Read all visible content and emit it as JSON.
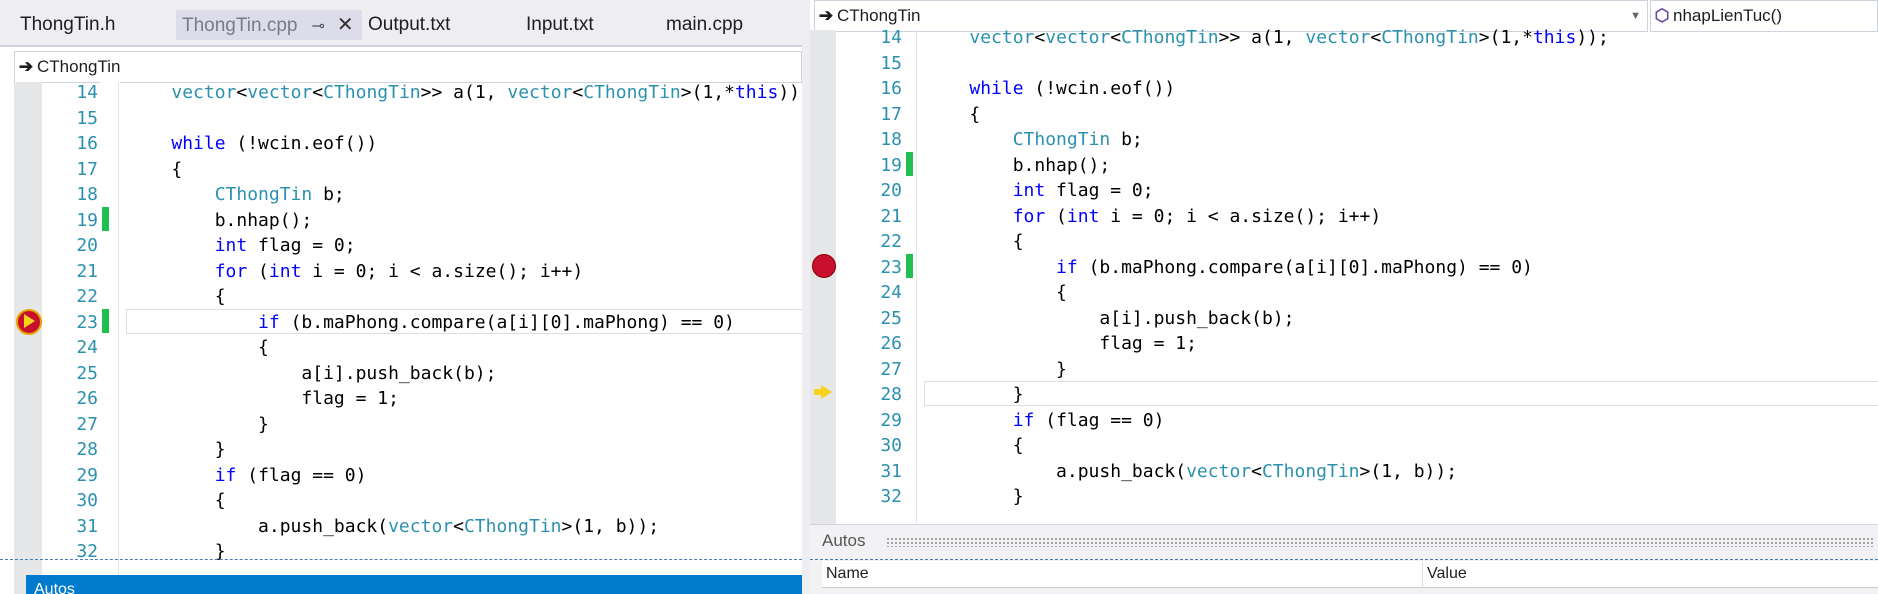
{
  "left": {
    "tabs": [
      {
        "label": "ThongTin.h",
        "active": false
      },
      {
        "label": "ThongTin.cpp",
        "active": true
      },
      {
        "label": "Output.txt",
        "active": false
      },
      {
        "label": "Input.txt",
        "active": false
      },
      {
        "label": "main.cpp",
        "active": false
      }
    ],
    "nav_class": "CThongTin",
    "line_numbers": [
      "14",
      "15",
      "16",
      "17",
      "18",
      "19",
      "20",
      "21",
      "22",
      "23",
      "24",
      "25",
      "26",
      "27",
      "28",
      "29",
      "30",
      "31",
      "32"
    ],
    "autos_label": "Autos"
  },
  "right": {
    "nav_class": "CThongTin",
    "nav_member": "nhapLienTuc()",
    "line_numbers": [
      "14",
      "15",
      "16",
      "17",
      "18",
      "19",
      "20",
      "21",
      "22",
      "23",
      "24",
      "25",
      "26",
      "27",
      "28",
      "29",
      "30",
      "31",
      "32"
    ],
    "autos_title": "Autos",
    "autos_columns": {
      "name": "Name",
      "value": "Value"
    }
  },
  "code_lines": [
    "    vector<vector<CThongTin>> a(1, vector<CThongTin>(1,*this));",
    "",
    "    while (!wcin.eof())",
    "    {",
    "        CThongTin b;",
    "        b.nhap();",
    "        int flag = 0;",
    "        for (int i = 0; i < a.size(); i++)",
    "        {",
    "            if (b.maPhong.compare(a[i][0].maPhong) == 0)",
    "            {",
    "                a[i].push_back(b);",
    "                flag = 1;",
    "            }",
    "        }",
    "        if (flag == 0)",
    "        {",
    "            a.push_back(vector<CThongTin>(1, b));",
    "        }"
  ],
  "colors": {
    "keyword": "#0000ff",
    "type": "#2b91af",
    "line_number": "#2b91af",
    "breakpoint": "#c8102e",
    "change_bar": "#20c050",
    "instruction_pointer": "#f6d31a",
    "autos_bar": "#007acc"
  }
}
